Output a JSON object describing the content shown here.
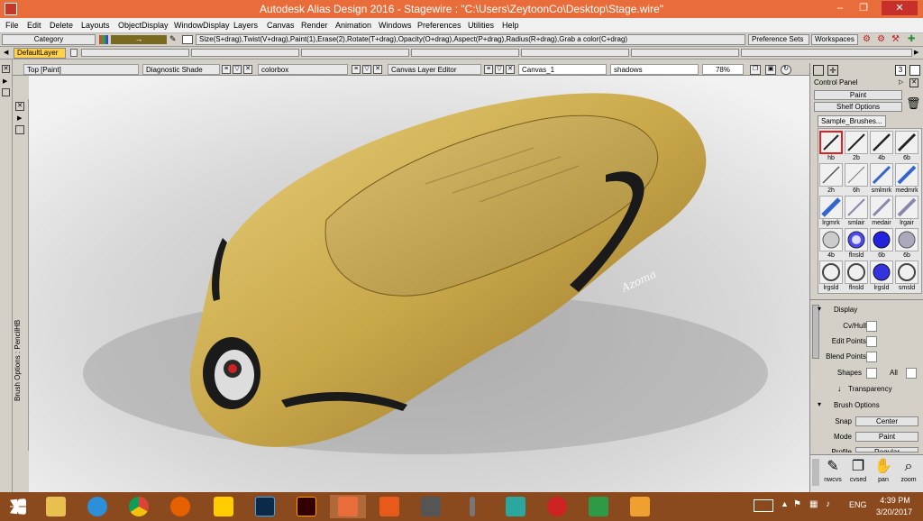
{
  "window": {
    "title": "Autodesk Alias Design 2016   -   Stagewire : \"C:\\Users\\ZeytoonCo\\Desktop\\Stage.wire\"",
    "minimize": "–",
    "restore": "❐",
    "close": "✕"
  },
  "menu": [
    "File",
    "Edit",
    "Delete",
    "Layouts",
    "ObjectDisplay",
    "WindowDisplay",
    "Layers",
    "Canvas",
    "Render",
    "Animation",
    "Windows",
    "Preferences",
    "Utilities",
    "Help"
  ],
  "toolbar": {
    "category": "Category",
    "hint": "Size(S+drag),Twist(V+drag),Paint(1),Erase(2),Rotate(T+drag),Opacity(O+drag),Aspect(P+drag),Radius(R+drag),Grab a color(C+drag)",
    "preference_sets": "Preference Sets",
    "workspaces": "Workspaces",
    "layer": "DefaultLayer"
  },
  "viewbar": {
    "view": "Top [Paint]",
    "shade": "Diagnostic Shade",
    "colorbox": "colorbox",
    "layer_editor": "Canvas Layer Editor",
    "canvas_name": "Canvas_1",
    "layer_name": "shadows",
    "zoom": "78%",
    "panel_num": "3"
  },
  "side_label": "Brush Options : PencilHB",
  "signature_text": "Azoma",
  "control_panel": {
    "title": "Control Panel",
    "mode": "Paint",
    "shelf_options": "Shelf Options",
    "shelf_tab": "Sample_Brushes...",
    "brushes": [
      "hb",
      "2b",
      "4b",
      "6b",
      "2h",
      "6h",
      "smlmrk",
      "medmrk",
      "lrgmrk",
      "smlair",
      "medair",
      "lrgair",
      "4b",
      "flnsld",
      "6b",
      "6b",
      "lrgsld",
      "flnsld",
      "lrgsld",
      "smsld"
    ],
    "display_header": "Display",
    "display_items": [
      "Cv/Hull",
      "Edit Points",
      "Blend Points",
      "Shapes"
    ],
    "all_label": "All",
    "transparency": "Transparency",
    "brush_options": "Brush Options",
    "snap_label": "Snap",
    "snap_value": "Center",
    "mode_label": "Mode",
    "mode_value": "Paint",
    "profile_label": "Profile",
    "profile_value": "Regular",
    "tools": [
      "nwcvs",
      "cvsed",
      "pan",
      "zoom"
    ]
  },
  "taskbar": {
    "lang": "ENG",
    "time": "4:39 PM",
    "date": "3/20/2017"
  },
  "colors": {
    "title": "#e86d3a",
    "taskbar": "#8a4a1e",
    "car_body": "#c9a84a",
    "selection": "#cc2222"
  }
}
